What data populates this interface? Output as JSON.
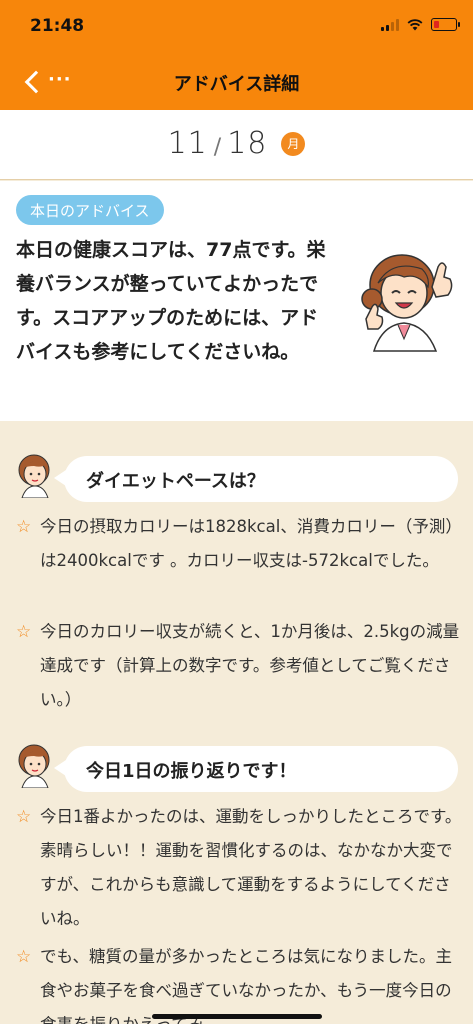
{
  "status_bar": {
    "time": "21:48"
  },
  "nav": {
    "title": "アドバイス詳細",
    "back_dots": "···"
  },
  "date": {
    "month": "11",
    "day": "18",
    "weekday": "月"
  },
  "advice": {
    "badge": "本日のアドバイス",
    "text": "本日の健康スコアは、77点です。栄養バランスが整っていてよかったです。スコアアップのためには、アドバイスも参考にしてくださいね。"
  },
  "sections": [
    {
      "title": "ダイエットペースは？",
      "items": [
        "今日の摂取カロリーは1828kcal、消費カロリー（予測）は2400kcalです 。カロリー収支は-572kcalでした。",
        "今日のカロリー収支が続くと、1か月後は、2.5kgの減量達成です（計算上の数字です。参考値としてご覧ください。）"
      ]
    },
    {
      "title": "今日1日の振り返りです！",
      "items": [
        "今日1番よかったのは、運動をしっかりしたところです。素晴らしい！！運動を習慣化するのは、なかなか大変ですが、これからも意識して運動をするようにしてくださいね。",
        "でも、糖質の量が多かったところは気になりました。主食やお菓子を食べ過ぎていなかったか、もう一度今日の食事を振りかえってみ"
      ]
    }
  ],
  "colors": {
    "header": "#f7860b",
    "badge": "#7cc7ec",
    "star": "#f28a1f",
    "background": "#f5ecd9"
  },
  "icons": {
    "back": "chevron-left-icon",
    "star": "star-outline-icon"
  }
}
